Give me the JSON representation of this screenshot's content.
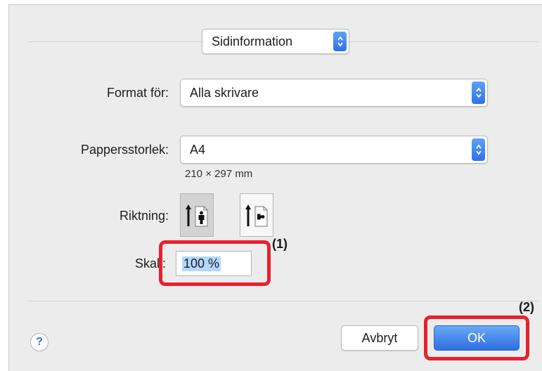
{
  "header_menu": {
    "value": "Sidinformation"
  },
  "format": {
    "label": "Format för:",
    "value": "Alla skrivare"
  },
  "paper": {
    "label": "Pappersstorlek:",
    "value": "A4",
    "dimensions": "210 × 297 mm"
  },
  "orientation": {
    "label": "Riktning:",
    "selected": "portrait"
  },
  "scale": {
    "label": "Skala:",
    "label_visible": "Skal",
    "value": "100 %"
  },
  "callouts": {
    "one": "(1)",
    "two": "(2)"
  },
  "buttons": {
    "cancel": "Avbryt",
    "ok": "OK",
    "help": "?"
  },
  "colors": {
    "accent": "#2f6fe0",
    "highlight": "#e8202e"
  }
}
